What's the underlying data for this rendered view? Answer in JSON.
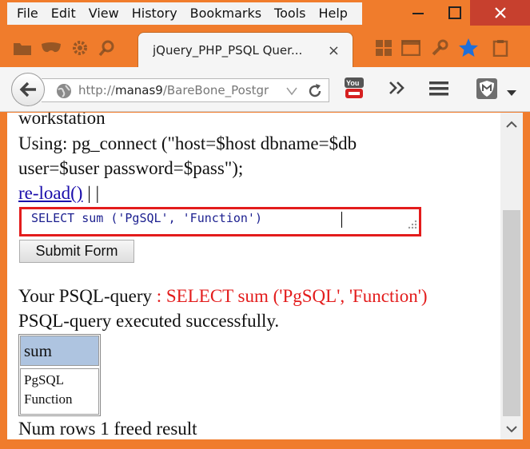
{
  "menu": [
    "File",
    "Edit",
    "View",
    "History",
    "Bookmarks",
    "Tools",
    "Help"
  ],
  "tab": {
    "title": "jQuery_PHP_PSQL Quer...",
    "close": "×"
  },
  "navbar": {
    "url_prefix": "http://",
    "url_host": "manas9",
    "url_path": "/BareBone_Postgr"
  },
  "content": {
    "line1": "workstation",
    "line2": "Using: pg_connect (\"host=$host dbname=$db",
    "line3": "user=$user password=$pass\");",
    "reload_link": "re-load()",
    "reload_sep": " | |",
    "query_value": "SELECT sum ('PgSQL', 'Function') ",
    "submit_label": "Submit Form",
    "your_query_label": "Your PSQL-query",
    "your_query_value": " : SELECT sum ('PgSQL', 'Function')",
    "status": "PSQL-query executed successfully.",
    "table_header": "sum",
    "table_cell_line1": "PgSQL",
    "table_cell_line2": "Function",
    "num_rows": "Num rows 1 freed result"
  },
  "colors": {
    "chrome": "#f07c2c",
    "close": "#c7402e",
    "query_border": "#e31c1c",
    "header_bg": "#aec4e0",
    "link": "#1a0dab"
  },
  "icons": [
    "back-arrow-icon",
    "globe-icon",
    "dropdown-arrow-icon",
    "reload-icon",
    "youtube-icon",
    "overflow-chevrons-icon",
    "hamburger-menu-icon",
    "shield-extension-icon",
    "bookmark-star-icon"
  ]
}
